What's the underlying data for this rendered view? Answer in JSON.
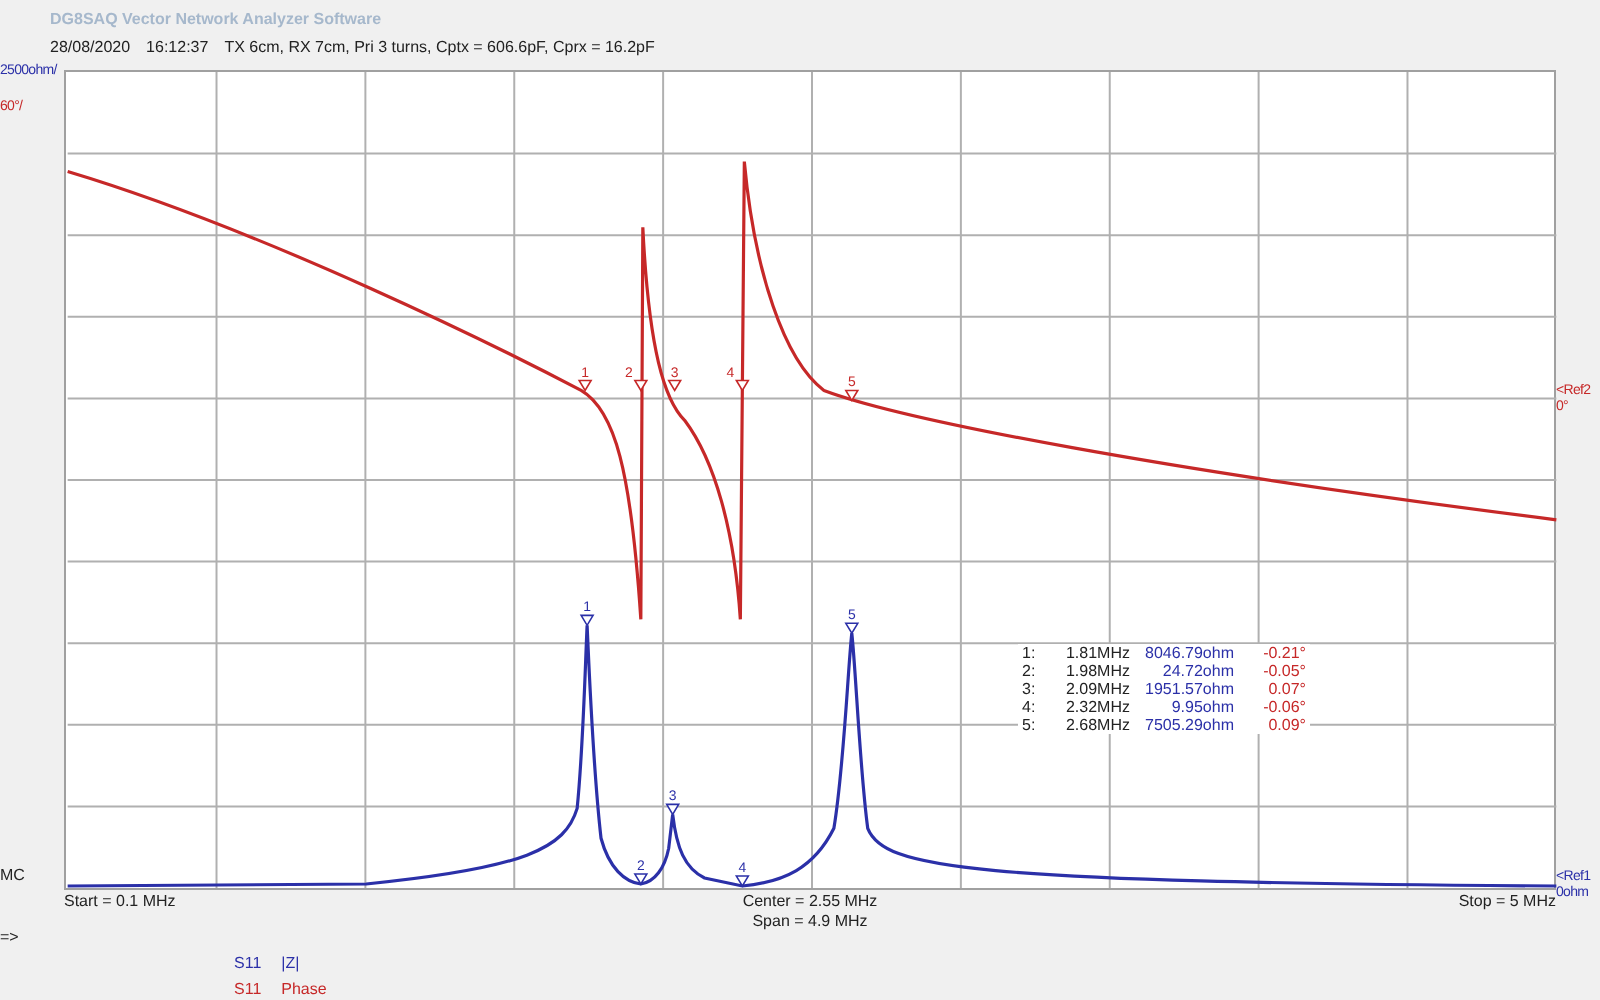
{
  "app_title": "DG8SAQ Vector Network Analyzer Software",
  "info": {
    "date": "28/08/2020",
    "time": "16:12:37",
    "note": "TX 6cm, RX 7cm, Pri 3 turns, Cptx = 606.6pF, Cprx = 16.2pF"
  },
  "scales": [
    {
      "kind": "magnitude",
      "text": "2500ohm/"
    },
    {
      "kind": "phase",
      "text": "60°/"
    }
  ],
  "mc": "MC",
  "refs": [
    {
      "kind": "phase",
      "arrow": "<Ref2",
      "value": "0°"
    },
    {
      "kind": "magnitude",
      "arrow": "<Ref1",
      "value": "0ohm"
    }
  ],
  "phase_markers": [
    "1",
    "2",
    "3",
    "4",
    "5"
  ],
  "magnitude_markers": [
    "1",
    "2",
    "3",
    "4",
    "5"
  ],
  "marker_table": [
    {
      "index": "1:",
      "freq": "1.81MHz",
      "magnitude": "8046.79ohm",
      "phase": "-0.21°"
    },
    {
      "index": "2:",
      "freq": "1.98MHz",
      "magnitude": "24.72ohm",
      "phase": "-0.05°"
    },
    {
      "index": "3:",
      "freq": "2.09MHz",
      "magnitude": "1951.57ohm",
      "phase": "0.07°"
    },
    {
      "index": "4:",
      "freq": "2.32MHz",
      "magnitude": "9.95ohm",
      "phase": "-0.06°"
    },
    {
      "index": "5:",
      "freq": "2.68MHz",
      "magnitude": "7505.29ohm",
      "phase": "0.09°"
    }
  ],
  "x_axis": {
    "start": "Start = 0.1 MHz",
    "center": "Center = 2.55 MHz",
    "span": "Span = 4.9 MHz",
    "stop": "Stop = 5 MHz"
  },
  "arrow": "=>",
  "legend": [
    {
      "kind": "magnitude",
      "param": "S11",
      "name": "|Z|"
    },
    {
      "kind": "phase",
      "param": "S11",
      "name": "Phase"
    }
  ]
}
